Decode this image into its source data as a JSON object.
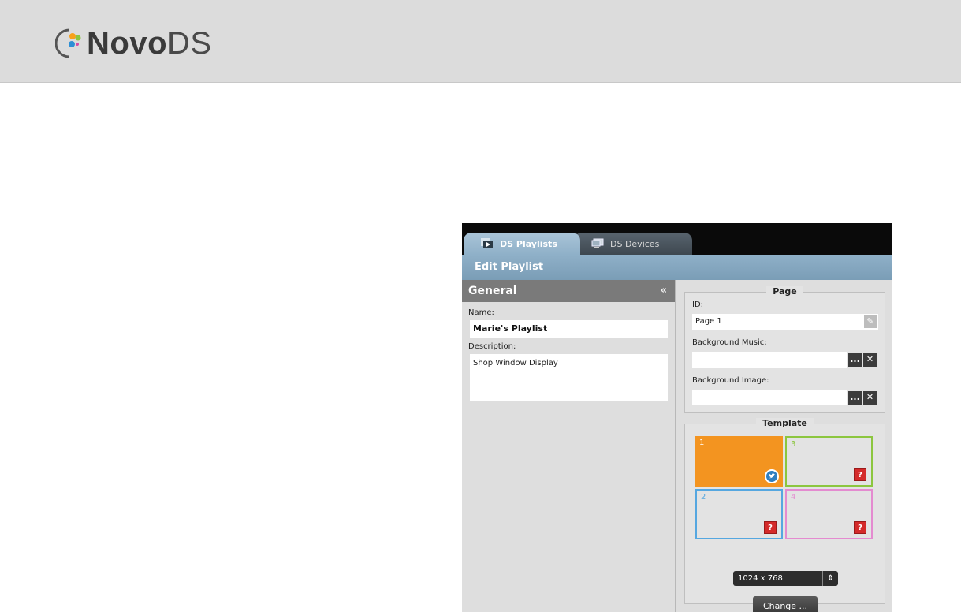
{
  "header": {
    "brand_bold": "Novo",
    "brand_light": "DS"
  },
  "tabs": [
    {
      "label": "DS Playlists",
      "icon": "playlist-icon",
      "active": true
    },
    {
      "label": "DS Devices",
      "icon": "monitor-icon",
      "active": false
    }
  ],
  "subheader": {
    "title": "Edit Playlist"
  },
  "general": {
    "title": "General",
    "collapse": "«",
    "name_label": "Name:",
    "name_value": "Marie's Playlist",
    "description_label": "Description:",
    "description_value": "Shop Window Display"
  },
  "page": {
    "title": "Page",
    "id_label": "ID:",
    "id_value": "Page 1",
    "bg_music_label": "Background Music:",
    "bg_music_value": "",
    "bg_image_label": "Background Image:",
    "bg_image_value": "",
    "browse_label": "...",
    "clear_label": "✕"
  },
  "template": {
    "title": "Template",
    "cells": [
      {
        "number": "1",
        "status": "twitter"
      },
      {
        "number": "3",
        "status": "?"
      },
      {
        "number": "2",
        "status": "?"
      },
      {
        "number": "4",
        "status": "?"
      }
    ],
    "resolution": "1024 x 768",
    "change_label": "Change ..."
  },
  "colors": {
    "cell1": "#f39420",
    "cell3": "#8cc63f",
    "cell2": "#55a7e0",
    "cell4": "#e48bd0"
  }
}
